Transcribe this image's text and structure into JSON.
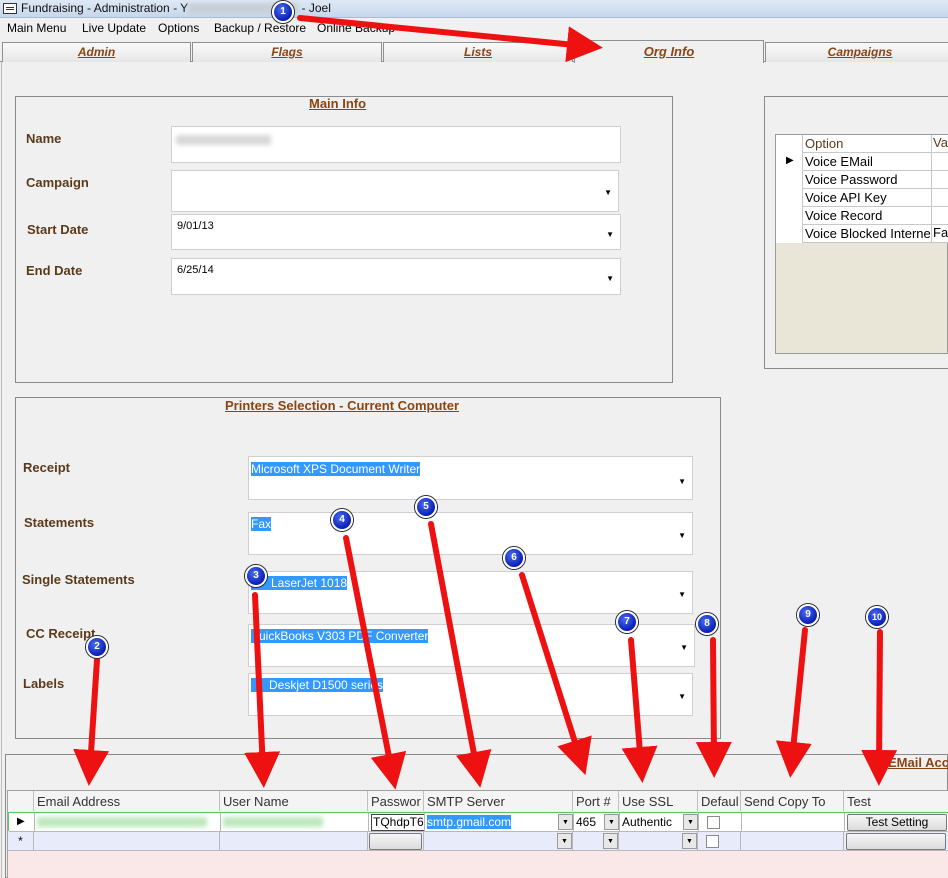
{
  "window": {
    "title_prefix": "Fundraising - Administration - Y",
    "title_suffix": "- Joel"
  },
  "menu": [
    "Main Menu",
    "Live Update",
    "Options",
    "Backup / Restore",
    "Online Backup"
  ],
  "tabs": [
    "Admin",
    "Flags",
    "Lists",
    "Org Info",
    "Campaigns"
  ],
  "active_tab": "Org Info",
  "main_info": {
    "title": "Main Info",
    "name_label": "Name",
    "campaign_label": "Campaign",
    "start_date_label": "Start Date",
    "start_date_value": "9/01/13",
    "end_date_label": "End Date",
    "end_date_value": "6/25/14"
  },
  "options_grid": {
    "headers": [
      "Option",
      "Va"
    ],
    "rows": [
      {
        "option": "Voice EMail",
        "value": ""
      },
      {
        "option": "Voice Password",
        "value": ""
      },
      {
        "option": "Voice API Key",
        "value": ""
      },
      {
        "option": "Voice Record",
        "value": ""
      },
      {
        "option": "Voice Blocked Interne",
        "value": "Fa"
      }
    ]
  },
  "printers": {
    "title": "Printers Selection - Current Computer",
    "receipt_label": "Receipt",
    "receipt_value": "Microsoft XPS Document Writer",
    "statements_label": "Statements",
    "statements_value": "Fax",
    "single_label": "Single Statements",
    "single_value": "LaserJet 1018",
    "cc_label": "CC Receipt",
    "cc_value": "uickBooks V303 PDF Converter",
    "labels_label": "Labels",
    "labels_value": "Deskjet D1500 series"
  },
  "email_accounts": {
    "title": "EMail Acc",
    "headers": [
      "Email Address",
      "User Name",
      "Passwor",
      "SMTP Server",
      "Port #",
      "Use SSL",
      "Defaul",
      "Send Copy To",
      "Test"
    ],
    "row": {
      "password": "TQhdpT6",
      "smtp": "smtp.gmail.com",
      "port": "465",
      "ssl": "Authentic",
      "test_button": "Test Setting"
    },
    "new_row_marker": "*"
  },
  "callouts": [
    "1",
    "2",
    "3",
    "4",
    "5",
    "6",
    "7",
    "8",
    "9",
    "10"
  ],
  "colors": {
    "accent_brown": "#8b4513",
    "selection_blue": "#3399ff",
    "arrow_red": "#ee1111",
    "badge_blue": "#0a1fb5"
  }
}
